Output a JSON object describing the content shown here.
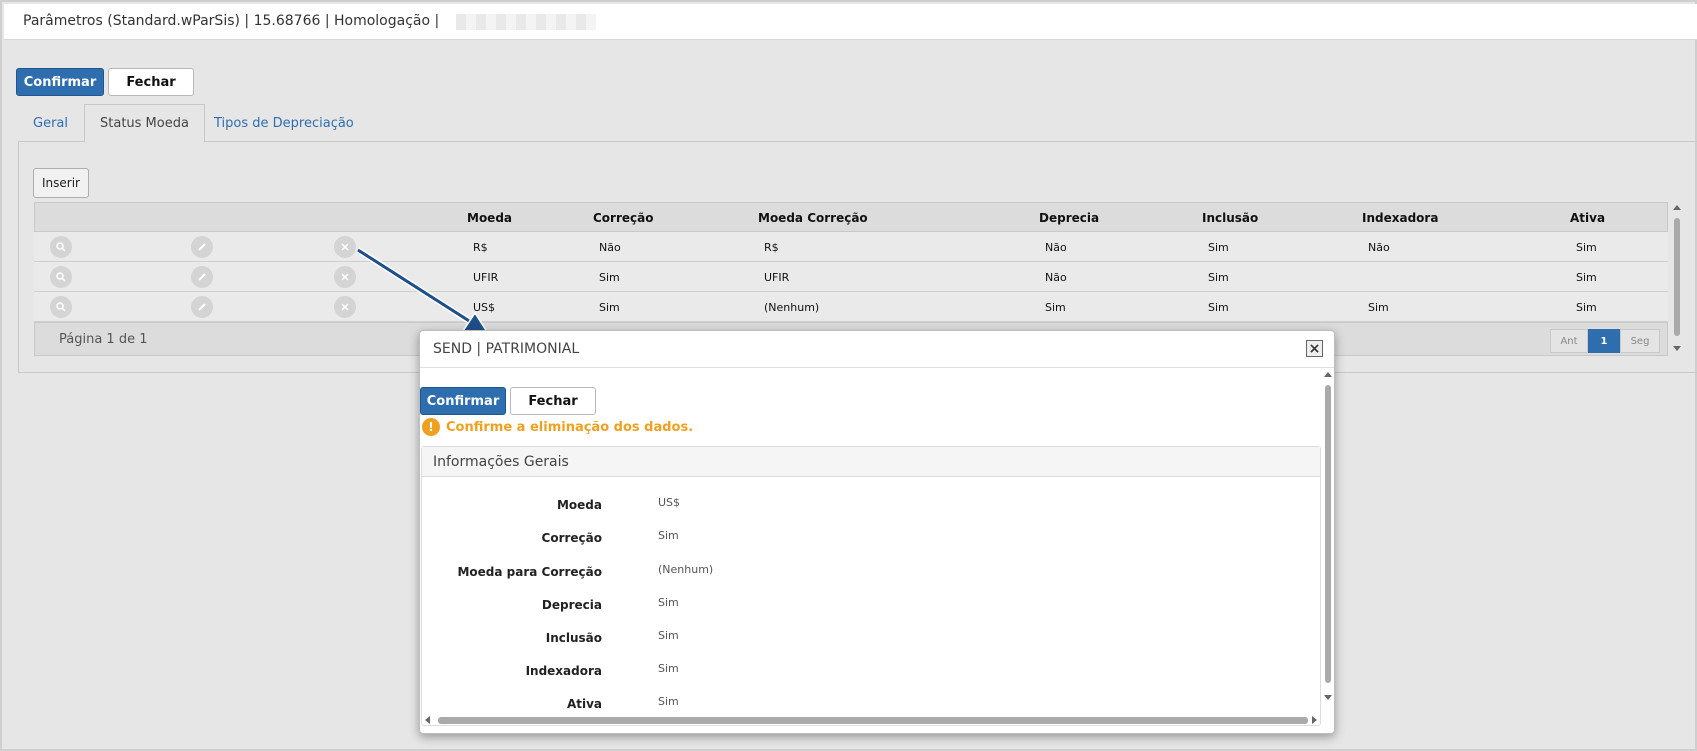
{
  "window": {
    "title": "Parâmetros (Standard.wParSis) | 15.68766 | Homologação |"
  },
  "toolbar": {
    "confirm_label": "Confirmar",
    "close_label": "Fechar"
  },
  "tabs": [
    {
      "label": "Geral",
      "active": false
    },
    {
      "label": "Status Moeda",
      "active": true
    },
    {
      "label": "Tipos de Depreciação",
      "active": false
    }
  ],
  "panel": {
    "insert_label": "Inserir"
  },
  "grid": {
    "columns": [
      "Moeda",
      "Correção",
      "Moeda Correção",
      "Deprecia",
      "Inclusão",
      "Indexadora",
      "Ativa"
    ],
    "rows": [
      {
        "moeda": "R$",
        "correcao": "Não",
        "moeda_correcao": "R$",
        "deprecia": "Não",
        "inclusao": "Sim",
        "indexadora": "Não",
        "ativa": "Sim"
      },
      {
        "moeda": "UFIR",
        "correcao": "Sim",
        "moeda_correcao": "UFIR",
        "deprecia": "Não",
        "inclusao": "Sim",
        "indexadora": "",
        "ativa": "Sim"
      },
      {
        "moeda": "US$",
        "correcao": "Sim",
        "moeda_correcao": "(Nenhum)",
        "deprecia": "Sim",
        "inclusao": "Sim",
        "indexadora": "Sim",
        "ativa": "Sim"
      }
    ],
    "row_icons": [
      "search-icon",
      "edit-icon",
      "delete-icon"
    ]
  },
  "pager": {
    "text": "Página 1 de 1",
    "prev_label": "Ant",
    "current_label": "1",
    "next_label": "Seg"
  },
  "modal": {
    "title": "SEND | PATRIMONIAL",
    "confirm_label": "Confirmar",
    "close_label": "Fechar",
    "warning": "Confirme a eliminação dos dados.",
    "section_title": "Informações Gerais",
    "fields": [
      {
        "label": "Moeda",
        "value": "US$"
      },
      {
        "label": "Correção",
        "value": "Sim"
      },
      {
        "label": "Moeda para Correção",
        "value": "(Nenhum)"
      },
      {
        "label": "Deprecia",
        "value": "Sim"
      },
      {
        "label": "Inclusão",
        "value": "Sim"
      },
      {
        "label": "Indexadora",
        "value": "Sim"
      },
      {
        "label": "Ativa",
        "value": "Sim"
      }
    ]
  },
  "colors": {
    "primary": "#2f6eae",
    "warning": "#f0a020"
  }
}
